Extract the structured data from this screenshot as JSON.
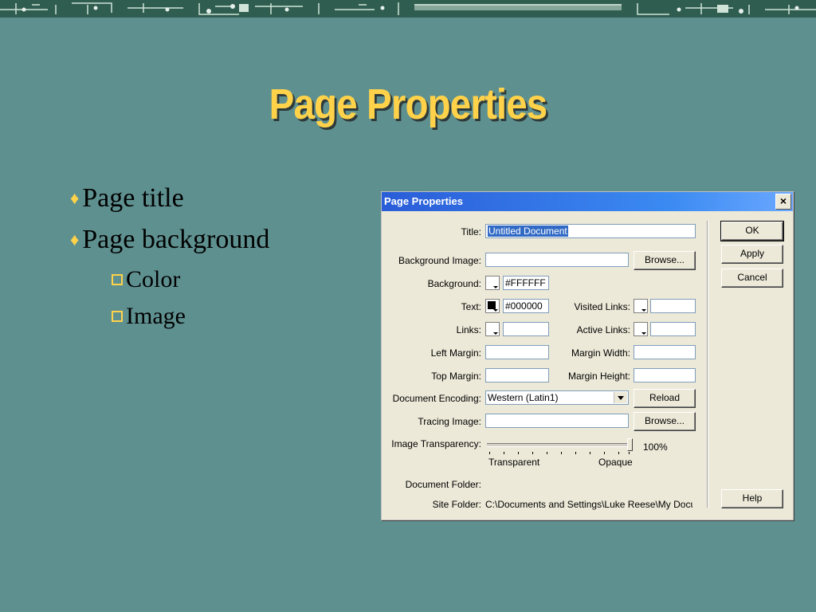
{
  "slide": {
    "title": "Page Properties",
    "bullets": [
      {
        "text": "Page title"
      },
      {
        "text": "Page background"
      }
    ],
    "sub_bullets": [
      {
        "text": "Color"
      },
      {
        "text": "Image"
      }
    ],
    "colors": {
      "background": "#5f9090",
      "title": "#ffd24a",
      "bullet_marker": "#ffd24a"
    }
  },
  "dialog": {
    "title": "Page Properties",
    "close_label": "×",
    "fields": {
      "title_label": "Title:",
      "title_value": "Untitled Document",
      "bg_image_label": "Background Image:",
      "bg_image_value": "",
      "background_label": "Background:",
      "background_value": "#FFFFFF",
      "text_label": "Text:",
      "text_value": "#000000",
      "links_label": "Links:",
      "links_value": "",
      "visited_links_label": "Visited Links:",
      "visited_links_value": "",
      "active_links_label": "Active Links:",
      "active_links_value": "",
      "left_margin_label": "Left Margin:",
      "left_margin_value": "",
      "top_margin_label": "Top Margin:",
      "top_margin_value": "",
      "margin_width_label": "Margin Width:",
      "margin_width_value": "",
      "margin_height_label": "Margin Height:",
      "margin_height_value": "",
      "encoding_label": "Document Encoding:",
      "encoding_value": "Western (Latin1)",
      "tracing_label": "Tracing Image:",
      "tracing_value": "",
      "transparency_label": "Image Transparency:",
      "transparency_value": "100%",
      "transparent_label": "Transparent",
      "opaque_label": "Opaque",
      "doc_folder_label": "Document Folder:",
      "doc_folder_value": "",
      "site_folder_label": "Site Folder:",
      "site_folder_value": "C:\\Documents and Settings\\Luke Reese\\My Docum"
    },
    "buttons": {
      "ok": "OK",
      "apply": "Apply",
      "cancel": "Cancel",
      "help": "Help",
      "browse": "Browse...",
      "reload": "Reload"
    }
  }
}
